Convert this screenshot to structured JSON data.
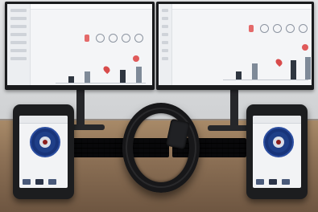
{
  "scene": {
    "objects": [
      "monitor-left",
      "monitor-right",
      "keyboard",
      "tracking-device-left",
      "tracking-device-right",
      "ankle-bracelet"
    ],
    "colors": {
      "screen_bg": "#f4f5f7",
      "accent_red": "#d84b4b",
      "badge_blue": "#1f3f88",
      "device_body": "#1c1d1f",
      "desk": "#8d7156"
    }
  },
  "monitor_left": {
    "icons": [
      "tag-icon",
      "person-icon",
      "home-icon",
      "people-icon",
      "location-pin-icon",
      "alert-dot-icon"
    ]
  },
  "monitor_right": {
    "icons": [
      "tag-icon",
      "person-icon",
      "home-icon",
      "people-icon",
      "location-pin-icon",
      "alert-dot-icon"
    ]
  },
  "device_left": {
    "icons": [
      "police-badge-icon",
      "message-icon",
      "call-icon",
      "menu-icon"
    ]
  },
  "device_right": {
    "icons": [
      "police-badge-icon",
      "message-icon",
      "call-icon",
      "menu-icon"
    ]
  }
}
